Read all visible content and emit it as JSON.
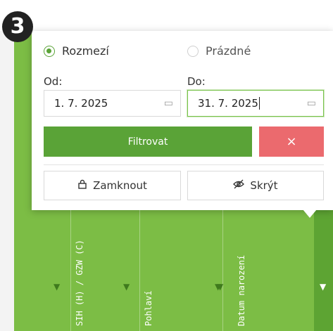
{
  "step_badge": "3",
  "filter_popup": {
    "mode_options": [
      {
        "label": "Rozmezí",
        "selected": true
      },
      {
        "label": "Prázdné",
        "selected": false
      }
    ],
    "from": {
      "label": "Od:",
      "value": "1. 7. 2025"
    },
    "to": {
      "label": "Do:",
      "value": "31. 7. 2025"
    },
    "filter_button": "Filtrovat",
    "clear_button": "×",
    "lock_button": "Zamknout",
    "hide_button": "Skrýt"
  },
  "table_columns": [
    {
      "label": "SIH (H) / GZW (C)"
    },
    {
      "label": "Pohlaví"
    },
    {
      "label": "Datum narození"
    }
  ],
  "colors": {
    "accent_green": "#5aa337",
    "header_green": "#7cbd45",
    "header_green_active": "#5da433",
    "danger_red": "#eb6a6e"
  }
}
